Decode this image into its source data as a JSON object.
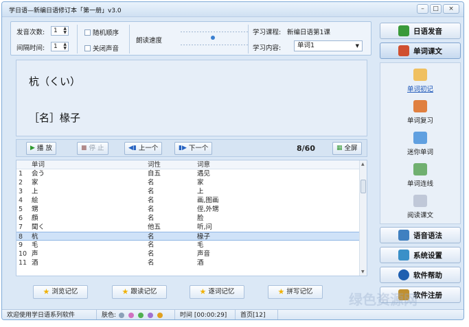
{
  "window": {
    "title": "学日语—新编日语修订本「第一册」v3.0",
    "buttons": {
      "minimize": "–",
      "maximize": "□",
      "close": "×"
    }
  },
  "controls": {
    "repeat_label": "发音次数:",
    "repeat_value": "1",
    "interval_label": "间隔时间:",
    "interval_value": "1",
    "random_label": "随机顺序",
    "mute_label": "关闭声音",
    "speed_label": "朗读速度",
    "course_label": "学习课程:",
    "course_value": "新编日语第1课",
    "content_label": "学习内容:",
    "content_value": "单词1"
  },
  "display": {
    "reading": "杭（くい）",
    "meaning": "［名］椽子"
  },
  "player": {
    "play": "播 放",
    "stop": "停 止",
    "prev": "上一个",
    "next": "下一个",
    "counter": "8/60",
    "fullscreen": "全屏"
  },
  "table": {
    "headers": [
      "",
      "单词",
      "词性",
      "词意"
    ],
    "rows": [
      {
        "n": "1",
        "word": "会う",
        "pos": "自五",
        "meaning": "遇见"
      },
      {
        "n": "2",
        "word": "家",
        "pos": "名",
        "meaning": "家"
      },
      {
        "n": "3",
        "word": "上",
        "pos": "名",
        "meaning": "上"
      },
      {
        "n": "4",
        "word": "絵",
        "pos": "名",
        "meaning": "画,图画"
      },
      {
        "n": "5",
        "word": "甥",
        "pos": "名",
        "meaning": "侄,外甥"
      },
      {
        "n": "6",
        "word": "顔",
        "pos": "名",
        "meaning": "脸"
      },
      {
        "n": "7",
        "word": "聞く",
        "pos": "他五",
        "meaning": "听,问"
      },
      {
        "n": "8",
        "word": "杭",
        "pos": "名",
        "meaning": "椽子"
      },
      {
        "n": "9",
        "word": "毛",
        "pos": "名",
        "meaning": "毛"
      },
      {
        "n": "10",
        "word": "声",
        "pos": "名",
        "meaning": "声音"
      },
      {
        "n": "11",
        "word": "酒",
        "pos": "名",
        "meaning": "酒"
      }
    ],
    "selected_index": 7
  },
  "memory_buttons": [
    "浏览记忆",
    "跟读记忆",
    "逐词记忆",
    "拼写记忆"
  ],
  "status": {
    "welcome": "欢迎使用学日语系列软件",
    "skin_label": "肤色:",
    "skin_colors": [
      "#8aa0b8",
      "#d070c0",
      "#50b050",
      "#a070d0",
      "#e0a020"
    ],
    "time": "时间 [00:00:29]",
    "page": "首页[12]"
  },
  "sidebar": {
    "top": [
      {
        "label": "日语发音",
        "icon": "book-icon",
        "color": "#3a9a3a"
      },
      {
        "label": "单词课文",
        "icon": "keyboard-icon",
        "color": "#d05030"
      }
    ],
    "sub": [
      {
        "label": "单词初记",
        "icon": "notebook-icon",
        "color": "#f0c060",
        "active": true
      },
      {
        "label": "单词复习",
        "icon": "books-icon",
        "color": "#e08040"
      },
      {
        "label": "迷你单词",
        "icon": "monitor-icon",
        "color": "#60a0e0"
      },
      {
        "label": "单词连线",
        "icon": "link-icon",
        "color": "#70b070"
      },
      {
        "label": "阅读课文",
        "icon": "reading-icon",
        "color": "#c0c8d8"
      }
    ],
    "bottom": [
      {
        "label": "语音语法",
        "icon": "speaker-icon",
        "color": "#4080c0"
      },
      {
        "label": "系统设置",
        "icon": "gears-icon",
        "color": "#3a90c8"
      },
      {
        "label": "软件帮助",
        "icon": "help-icon",
        "color": "#1f5fb0"
      },
      {
        "label": "软件注册",
        "icon": "register-icon",
        "color": "#c09030"
      }
    ]
  },
  "watermark": "绿色资源网"
}
